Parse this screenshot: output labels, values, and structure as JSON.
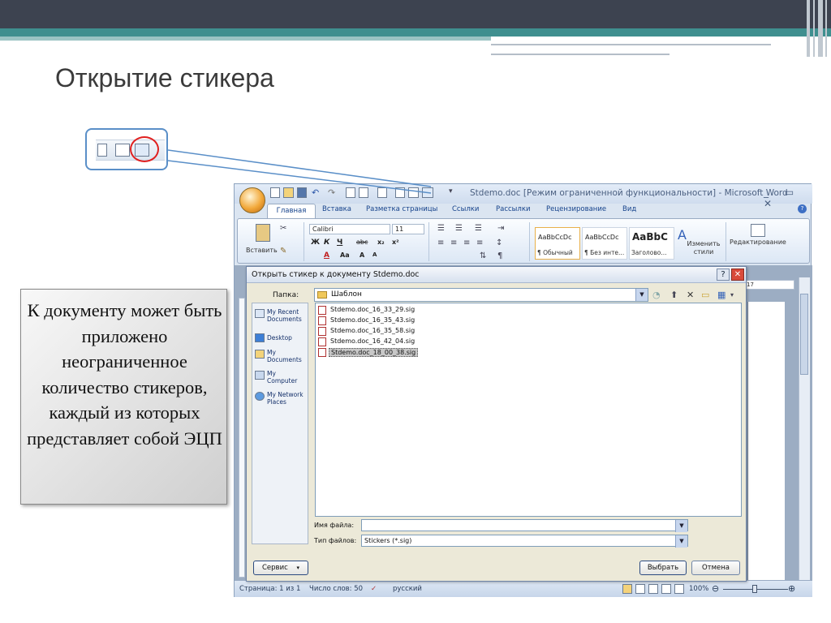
{
  "slide": {
    "title": "Открытие стикера",
    "note": "К документу может быть приложено неограниченное количество стикеров, каждый из которых представляет собой ЭЦП"
  },
  "word": {
    "title": "Stdemo.doc [Режим ограниченной функциональности] - Microsoft Word",
    "window_controls": "_ ▭ ✕",
    "tabs": [
      "Главная",
      "Вставка",
      "Разметка страницы",
      "Ссылки",
      "Рассылки",
      "Рецензирование",
      "Вид"
    ],
    "ribbon": {
      "paste": "Вставить",
      "font_name": "Calibri",
      "font_size": "11",
      "styles": [
        {
          "sample": "AaBbCcDc",
          "name": "¶ Обычный"
        },
        {
          "sample": "AaBbCcDc",
          "name": "¶ Без инте..."
        },
        {
          "sample": "AaBbC",
          "name": "Заголово..."
        }
      ],
      "change_styles": "Изменить стили",
      "editing": "Редактирование",
      "ruler_mark": "17"
    },
    "status": {
      "page": "Страница: 1 из 1",
      "words": "Число слов: 50",
      "language": "русский",
      "zoom": "100%"
    }
  },
  "dialog": {
    "title": "Открыть стикер к документу Stdemo.doc",
    "help": "?",
    "close": "✕",
    "folder_label": "Папка:",
    "folder_value": "Шаблон",
    "places": [
      {
        "label": "My Recent Documents"
      },
      {
        "label": "Desktop"
      },
      {
        "label": "My Documents"
      },
      {
        "label": "My Computer"
      },
      {
        "label": "My Network Places"
      }
    ],
    "files": [
      "Stdemo.doc_16_33_29.sig",
      "Stdemo.doc_16_35_43.sig",
      "Stdemo.doc_16_35_58.sig",
      "Stdemo.doc_16_42_04.sig",
      "Stdemo.doc_18_00_38.sig"
    ],
    "selected_file_index": 4,
    "filename_label": "Имя файла:",
    "filename_value": "",
    "filetype_label": "Тип файлов:",
    "filetype_value": "Stickers (*.sig)",
    "tools_button": "Сервис",
    "open_button": "Выбрать",
    "cancel_button": "Отмена"
  },
  "colors": {
    "header_dark": "#3d4350",
    "header_teal": "#3f8f8f",
    "callout_border": "#5a8fc8",
    "highlight_ring": "#e02020"
  }
}
